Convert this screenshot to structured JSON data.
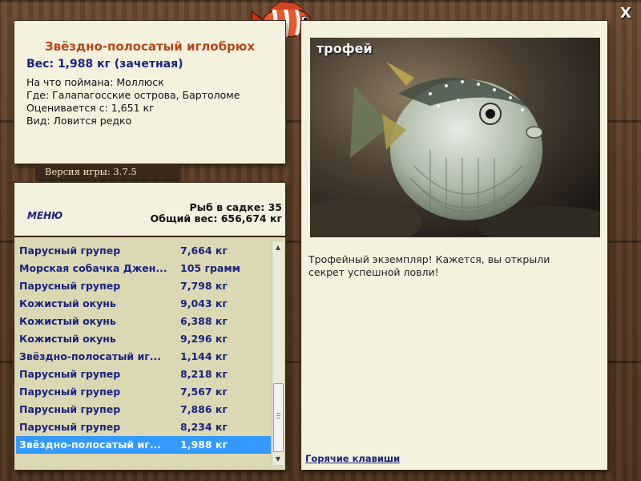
{
  "fish_info": {
    "title": "Звёздно-полосатый иглобрюх",
    "weight": "Вес: 1,988 кг (зачетная)",
    "bait": "На что поймана: Моллюск",
    "location": "Где: Галапагосские острова, Бартоломе",
    "valued_from": "Оценивается с: 1,651 кг",
    "type": "Вид: Ловится редко"
  },
  "version": "Версия игры: 3.7.5",
  "status": {
    "menu_label": "МЕНЮ",
    "fish_count": "Рыб в садке: 35",
    "total_weight": "Общий вес: 656,674 кг"
  },
  "catch_list": [
    {
      "name": "Парусный групер",
      "weight": "7,664 кг"
    },
    {
      "name": "Морская собачка Джен...",
      "weight": "105 грамм"
    },
    {
      "name": "Парусный групер",
      "weight": "7,798 кг"
    },
    {
      "name": "Кожистый окунь",
      "weight": "9,043 кг"
    },
    {
      "name": "Кожистый окунь",
      "weight": "6,388 кг"
    },
    {
      "name": "Кожистый окунь",
      "weight": "9,296 кг"
    },
    {
      "name": "Звёздно-полосатый иг...",
      "weight": "1,144 кг"
    },
    {
      "name": "Парусный групер",
      "weight": "8,218 кг"
    },
    {
      "name": "Парусный групер",
      "weight": "7,567 кг"
    },
    {
      "name": "Парусный групер",
      "weight": "7,886 кг"
    },
    {
      "name": "Парусный групер",
      "weight": "8,234 кг"
    },
    {
      "name": "Звёздно-полосатый иг...",
      "weight": "1,988 кг"
    }
  ],
  "selected_index": 11,
  "trophy": {
    "label": "трофей",
    "text": "Трофейный экземпляр! Кажется, вы открыли секрет успешной ловли!"
  },
  "hotkeys_label": "Горячие клавиши",
  "close_label": "X",
  "colors": {
    "title": "#b5471b",
    "accent": "#1a237e",
    "selection": "#3399ff",
    "panel": "#f4f1de"
  }
}
